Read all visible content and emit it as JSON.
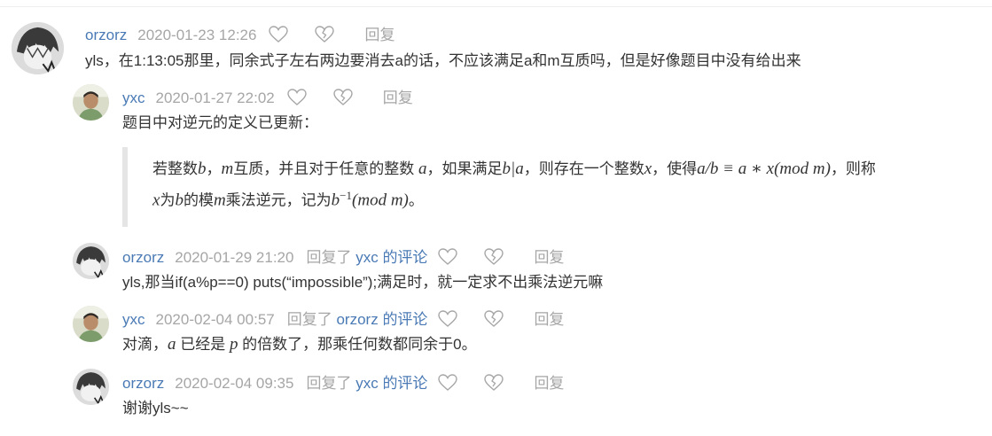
{
  "labels": {
    "reply": "回复",
    "replied_prefix": "回复了",
    "replied_suffix": "的评论"
  },
  "colors": {
    "author": "#4a7ab5",
    "meta": "#a6a6a6",
    "text": "#333333",
    "quote_border": "#e5e5e5"
  },
  "icons": {
    "like": "heart-icon",
    "dislike": "broken-heart-icon"
  },
  "comments": [
    {
      "author": "orzorz",
      "time": "2020-01-23 12:26",
      "text": "yls，在1:13:05那里，同余式子左右两边要消去a的话，不应该满足a和m互质吗，但是好像题目中没有给出来"
    },
    {
      "author": "yxc",
      "time": "2020-01-27 22:02",
      "text": "题目中对逆元的定义已更新：",
      "quote": {
        "line1": [
          "若整数",
          "b",
          "，",
          "m",
          "互质，并且对于任意的整数 ",
          "a",
          "，如果满足",
          "b|a",
          "，则存在一个整数",
          "x",
          "，使得",
          "a/b ≡ a ∗ x(mod m)",
          "，则称"
        ],
        "line2": [
          "x",
          "为",
          "b",
          "的模",
          "m",
          "乘法逆元，记为",
          "b",
          "−1",
          "(mod m)",
          "。"
        ]
      }
    },
    {
      "author": "orzorz",
      "time": "2020-01-29 21:20",
      "reply_to": "yxc",
      "text": "yls,那当if(a%p==0) puts(“impossible”);满足时，就一定求不出乘法逆元嘛"
    },
    {
      "author": "yxc",
      "time": "2020-02-04 00:57",
      "reply_to": "orzorz",
      "text": [
        "对滴，",
        "a",
        " 已经是 ",
        "p",
        " 的倍数了，那乘任何数都同余于0。"
      ]
    },
    {
      "author": "orzorz",
      "time": "2020-02-04 09:35",
      "reply_to": "yxc",
      "text": "谢谢yls~~"
    }
  ]
}
